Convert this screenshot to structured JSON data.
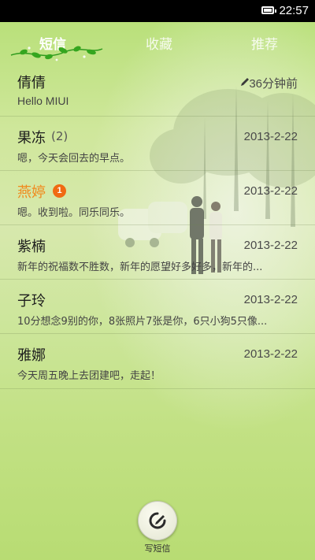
{
  "status_bar": {
    "time": "22:57",
    "battery_icon": "battery-full-icon"
  },
  "tabs": [
    {
      "label": "短信",
      "active": true
    },
    {
      "label": "收藏",
      "active": false
    },
    {
      "label": "推荐",
      "active": false
    }
  ],
  "threads": [
    {
      "name": "倩倩",
      "count": "",
      "badge": "",
      "date": "36分钟前",
      "preview": "Hello MIUI",
      "draft": true,
      "unread": false
    },
    {
      "name": "果冻",
      "count": "(2)",
      "badge": "",
      "date": "2013-2-22",
      "preview": "嗯，今天会回去的早点。",
      "draft": false,
      "unread": false
    },
    {
      "name": "燕婷",
      "count": "",
      "badge": "1",
      "date": "2013-2-22",
      "preview": "嗯。收到啦。同乐同乐。",
      "draft": false,
      "unread": true
    },
    {
      "name": "紫楠",
      "count": "",
      "badge": "",
      "date": "2013-2-22",
      "preview": "新年的祝福数不胜数，新年的愿望好多好多，新年的...",
      "draft": false,
      "unread": false
    },
    {
      "name": "子玲",
      "count": "",
      "badge": "",
      "date": "2013-2-22",
      "preview": "10分想念9别的你，8张照片7张是你，6只小狗5只像...",
      "draft": false,
      "unread": false
    },
    {
      "name": "雅娜",
      "count": "",
      "badge": "",
      "date": "2013-2-22",
      "preview": "今天周五晚上去团建吧，走起！",
      "draft": false,
      "unread": false
    }
  ],
  "compose": {
    "label": "写短信",
    "icon": "compose-icon"
  },
  "colors": {
    "accent_unread": "#f08a1e",
    "badge": "#f06a12",
    "background": "#c8e48f"
  }
}
